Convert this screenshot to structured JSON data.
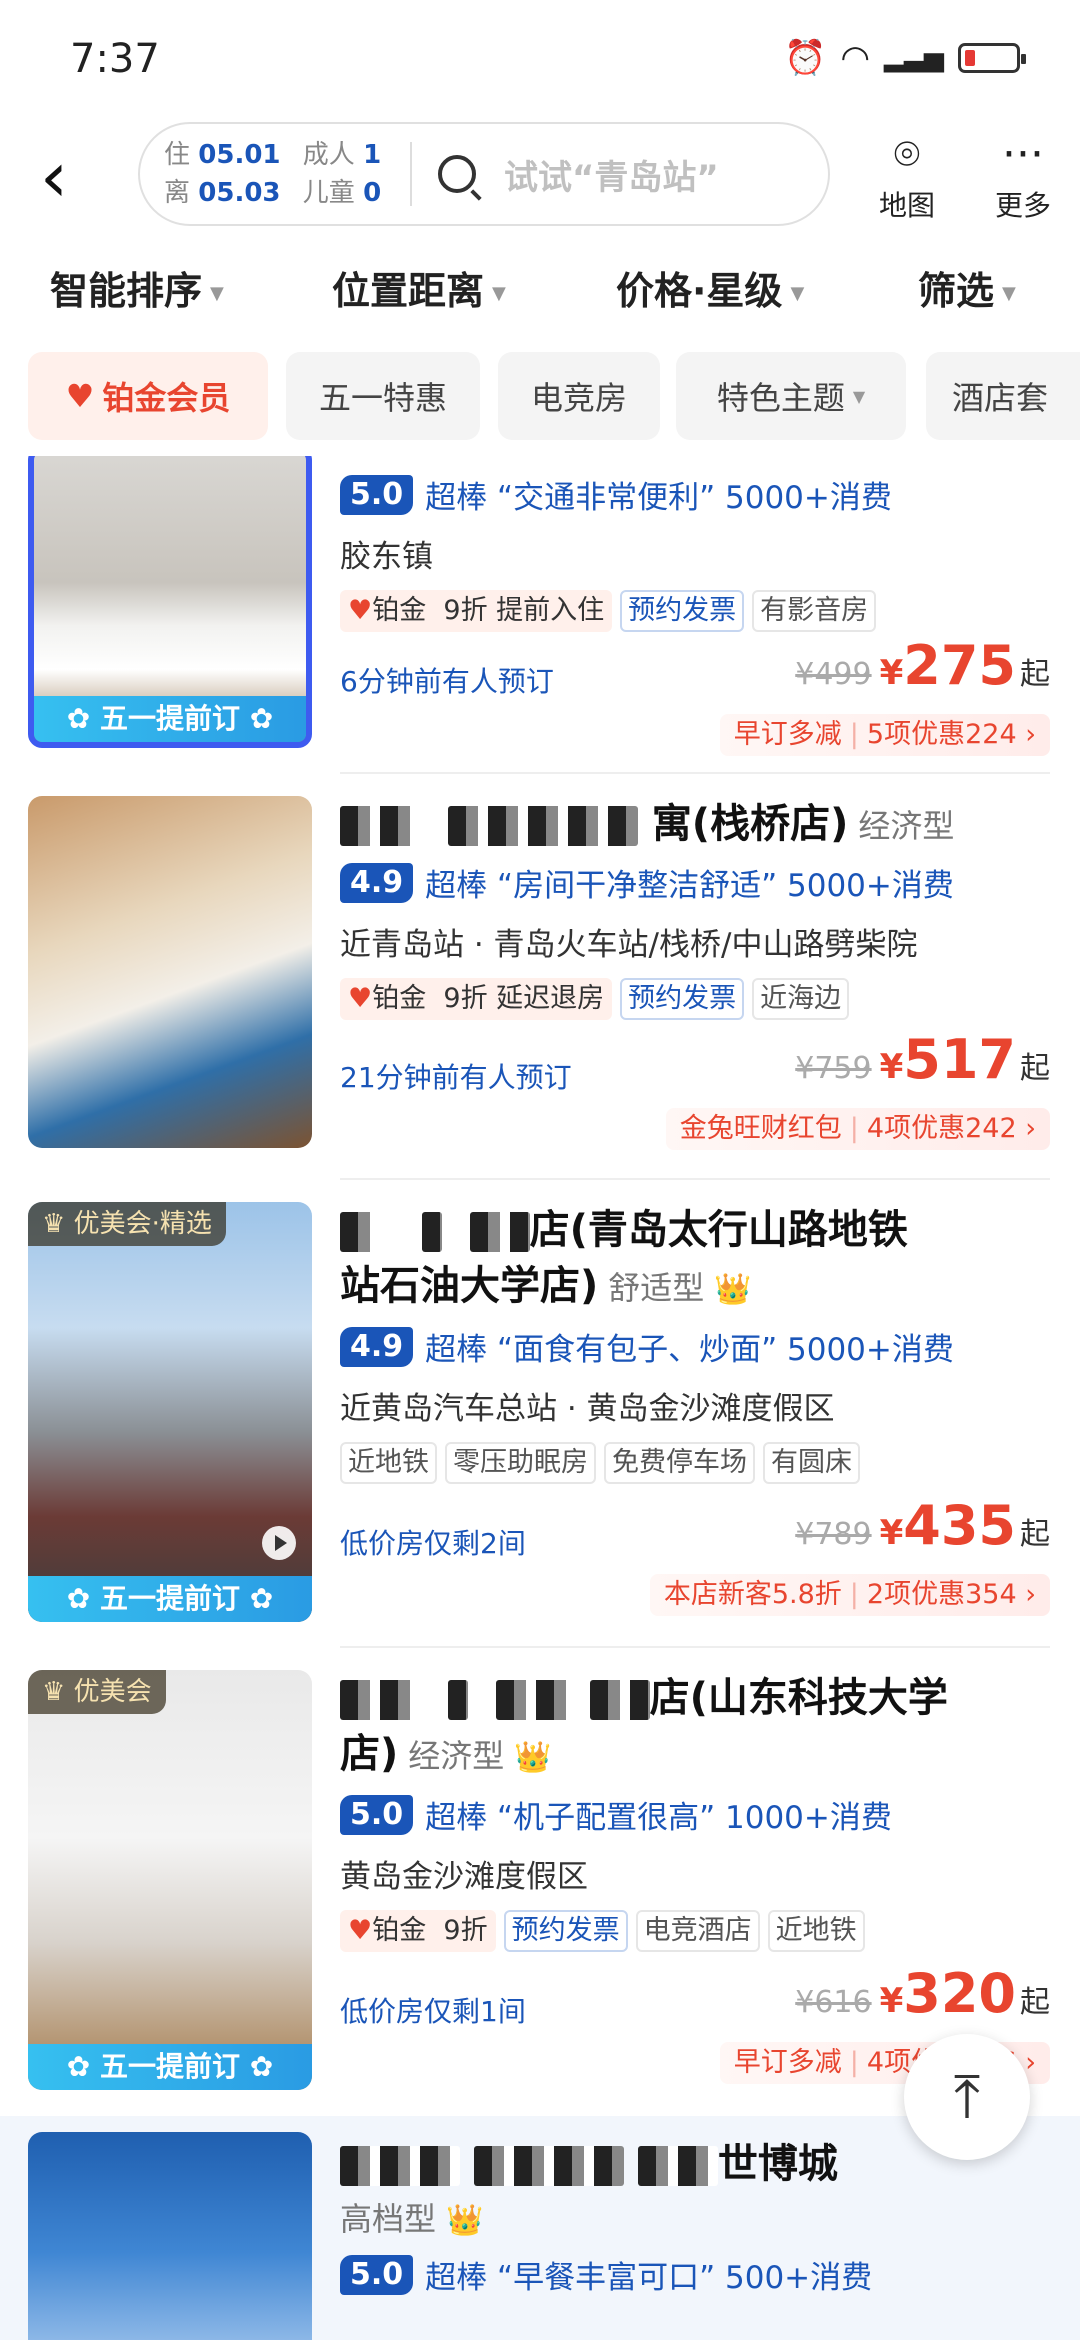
{
  "status": {
    "time": "7:37"
  },
  "header": {
    "checkin_label": "住",
    "checkin_date": "05.01",
    "checkout_label": "离",
    "checkout_date": "05.03",
    "adults_label": "成人",
    "adults": "1",
    "children_label": "儿童",
    "children": "0",
    "search_placeholder": "试试“青岛站”",
    "map_label": "地图",
    "more_label": "更多"
  },
  "sorts": [
    "智能排序",
    "位置距离",
    "价格·星级",
    "筛选"
  ],
  "chips": [
    "铂金会员",
    "五一特惠",
    "电竞房",
    "特色主题",
    "酒店套"
  ],
  "hotels": [
    {
      "rating": "5.0",
      "praise": "超棒",
      "quote": "“交通非常便利”",
      "reviews": "5000+消费",
      "location": "胶东镇",
      "vip_label": "铂金",
      "perks": [
        "9折",
        "提前入住"
      ],
      "tags": [
        "预约发票",
        "有影音房"
      ],
      "note": "6分钟前有人预订",
      "old_price": "¥499",
      "currency": "¥",
      "price": "275",
      "suffix": "起",
      "promo1": "早订多减",
      "promo2": "5项优惠224 ›",
      "ribbon": "✿ 五一提前订 ✿"
    },
    {
      "name": "寓(栈桥店)",
      "grade": "经济型",
      "rating": "4.9",
      "praise": "超棒",
      "quote": "“房间干净整洁舒适”",
      "reviews": "5000+消费",
      "location": "近青岛站 · 青岛火车站/栈桥/中山路劈柴院",
      "vip_label": "铂金",
      "perks": [
        "9折",
        "延迟退房"
      ],
      "tags": [
        "预约发票",
        "近海边"
      ],
      "note": "21分钟前有人预订",
      "old_price": "¥759",
      "currency": "¥",
      "price": "517",
      "suffix": "起",
      "promo1": "金兔旺财红包",
      "promo2": "4项优惠242 ›"
    },
    {
      "badge": "优美会·精选",
      "name_line1": "店(青岛太行山路地铁",
      "name_line2": "站石油大学店)",
      "grade": "舒适型",
      "rating": "4.9",
      "praise": "超棒",
      "quote": "“面食有包子、炒面”",
      "reviews": "5000+消费",
      "location": "近黄岛汽车总站 · 黄岛金沙滩度假区",
      "tags": [
        "近地铁",
        "零压助眠房",
        "免费停车场",
        "有圆床"
      ],
      "note": "低价房仅剩2间",
      "old_price": "¥789",
      "currency": "¥",
      "price": "435",
      "suffix": "起",
      "promo1": "本店新客5.8折",
      "promo2": "2项优惠354 ›",
      "ribbon": "✿ 五一提前订 ✿"
    },
    {
      "badge": "优美会",
      "name_line1": "店(山东科技大学",
      "name_line2": "店)",
      "grade": "经济型",
      "rating": "5.0",
      "praise": "超棒",
      "quote": "“机子配置很高”",
      "reviews": "1000+消费",
      "location": "黄岛金沙滩度假区",
      "vip_label": "铂金",
      "perks": [
        "9折"
      ],
      "tags": [
        "预约发票",
        "电竞酒店",
        "近地铁"
      ],
      "note": "低价房仅剩1间",
      "old_price": "¥616",
      "currency": "¥",
      "price": "320",
      "suffix": "起",
      "promo1": "早订多减",
      "promo2": "4项优惠296 ›",
      "ribbon": "✿ 五一提前订 ✿"
    },
    {
      "name_tail": "世博城",
      "grade": "高档型",
      "rating": "5.0",
      "praise": "超棒",
      "quote": "“早餐丰富可口”",
      "reviews": "500+消费"
    }
  ],
  "totop_icon": "arrow-up-icon"
}
